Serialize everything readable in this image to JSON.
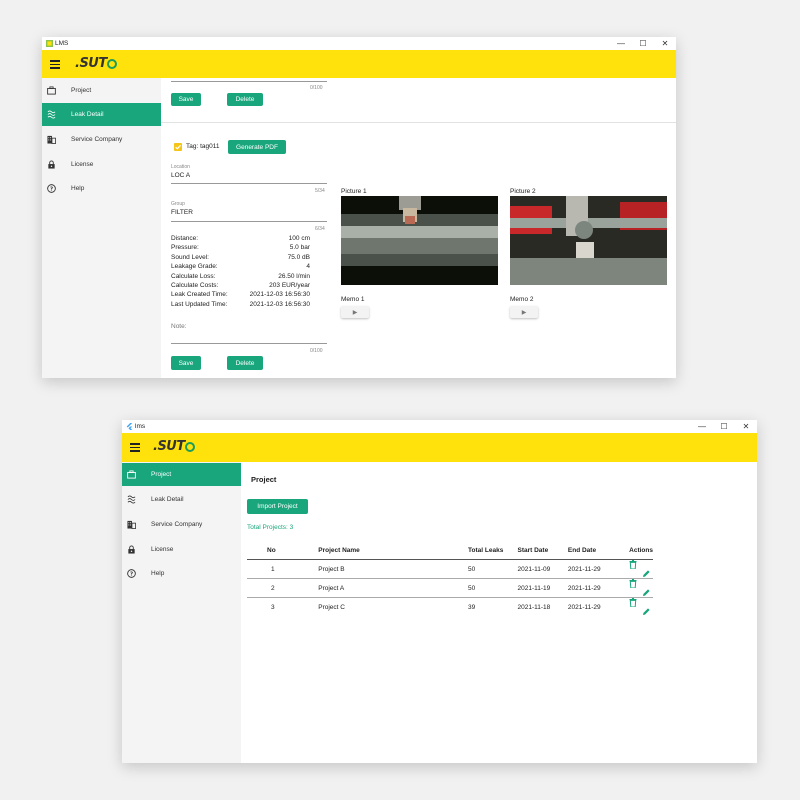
{
  "window1": {
    "title": "LMS",
    "logo": ".SUTO",
    "sidebar": [
      {
        "label": "Project",
        "icon": "briefcase-icon",
        "active": false
      },
      {
        "label": "Leak Detail",
        "icon": "leak-wave-icon",
        "active": true
      },
      {
        "label": "Service Company",
        "icon": "building-icon",
        "active": false
      },
      {
        "label": "License",
        "icon": "lock-icon",
        "active": false
      },
      {
        "label": "Help",
        "icon": "help-circle-icon",
        "active": false
      }
    ],
    "top_counter": "0/100",
    "save_label": "Save",
    "delete_label": "Delete",
    "tag": {
      "label": "Tag: tag011",
      "checked": true
    },
    "generate_pdf_label": "Generate PDF",
    "location": {
      "label": "Location",
      "value": "LOC A",
      "counter": "5/34"
    },
    "group": {
      "label": "Group",
      "value": "FILTER",
      "counter": "6/34"
    },
    "details": [
      {
        "label": "Distance:",
        "value": "100 cm"
      },
      {
        "label": "Pressure:",
        "value": "5.0 bar"
      },
      {
        "label": "Sound Level:",
        "value": "75.0 dB"
      },
      {
        "label": "Leakage Grade:",
        "value": "4"
      },
      {
        "label": "Calculate Loss:",
        "value": "26.50 l/min"
      },
      {
        "label": "Calculate Costs:",
        "value": "203 EUR/year"
      },
      {
        "label": "Leak Created Time:",
        "value": "2021-12-03 16:56:30"
      },
      {
        "label": "Last Updated Time:",
        "value": "2021-12-03 16:56:30"
      }
    ],
    "note_label": "Note:",
    "note_counter": "0/100",
    "picture1_label": "Picture 1",
    "picture2_label": "Picture 2",
    "memo1_label": "Memo 1",
    "memo2_label": "Memo 2",
    "play_glyph": "▶"
  },
  "window2": {
    "title": "lms",
    "logo": ".SUTO",
    "sidebar": [
      {
        "label": "Project",
        "icon": "briefcase-icon",
        "active": true
      },
      {
        "label": "Leak Detail",
        "icon": "leak-wave-icon",
        "active": false
      },
      {
        "label": "Service Company",
        "icon": "building-icon",
        "active": false
      },
      {
        "label": "License",
        "icon": "lock-icon",
        "active": false
      },
      {
        "label": "Help",
        "icon": "help-circle-icon",
        "active": false
      }
    ],
    "page_title": "Project",
    "import_label": "Import Project",
    "total_projects": "Total Projects: 3",
    "table": {
      "headers": [
        "No",
        "Project Name",
        "Total Leaks",
        "Start Date",
        "End Date",
        "Actions"
      ],
      "rows": [
        {
          "no": "1",
          "name": "Project B",
          "leaks": "50",
          "start": "2021-11-09",
          "end": "2021-11-29"
        },
        {
          "no": "2",
          "name": "Project A",
          "leaks": "50",
          "start": "2021-11-19",
          "end": "2021-11-29"
        },
        {
          "no": "3",
          "name": "Project C",
          "leaks": "39",
          "start": "2021-11-18",
          "end": "2021-11-29"
        }
      ]
    }
  },
  "window_controls": {
    "minimize": "—",
    "maximize": "☐",
    "close": "✕"
  },
  "colors": {
    "accent": "#19a67c",
    "header": "#ffe20c",
    "logo_ring": "#1a9d5c"
  }
}
